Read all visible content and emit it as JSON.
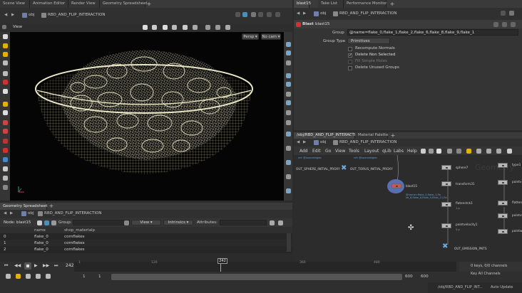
{
  "left_tabs": {
    "items": [
      "Scene View",
      "Animation Editor",
      "Render View",
      "Geometry Spreadsheet"
    ],
    "add": "+"
  },
  "left_path": {
    "context": "obj",
    "node": "RBD_AND_FLIP_INTERACTION"
  },
  "viewport": {
    "label": "View",
    "camera_btn": "Persp",
    "cam_btn": "No cam"
  },
  "right_top_tabs": {
    "items": [
      "blast15",
      "Take List",
      "Performance Monitor"
    ],
    "add": "+"
  },
  "right_top_path": {
    "context": "obj",
    "node": "RBD_AND_FLIP_INTERACTION"
  },
  "params": {
    "node_type": "Blast",
    "node_name": "blast15",
    "group_label": "Group",
    "group_value": "@name=flake_0,flake_1,flake_2,flake_6,flake_8,flake_9,flake_1",
    "group_type_label": "Group Type",
    "group_type_value": "Primitives",
    "recompute_normals": "Recompute Normals",
    "delete_non_selected": "Delete Non Selected",
    "fill_simple_holes": "Fill Simple Holes",
    "delete_unused_groups": "Delete Unused Groups"
  },
  "net_tabs": {
    "items": [
      "/obj/RBD_AND_FLIP_INTERACTION",
      "Material Palette"
    ],
    "add": "+"
  },
  "net_path": {
    "context": "obj",
    "node": "RBD_AND_FLIP_INTERACTION"
  },
  "net_menu": [
    "Add",
    "Edit",
    "Go",
    "View",
    "Tools",
    "Layout",
    "qLib",
    "Labs",
    "Help"
  ],
  "net_watermark": "Geometry",
  "net_nodes": {
    "out_sphere": "OUT_SPHERE_INITIAL_PROXY",
    "out_torus": "OUT_TORUS_INITIAL_PROXY",
    "ref_sphere": "ref: @sourcestgeo",
    "ref_torus": "ref: @sourcestgeo",
    "blast": "blast15",
    "blast_sub": "@name=flake_0,flake_1,fla ke_6,flake_8,flake_9,flake_11,fla",
    "sphere": "sphere7",
    "transform": "transform31",
    "flatten": "flatenstck1",
    "point_velocity": "pointvelocity1",
    "out_emission": "OUT_EMISSION_PNTS",
    "small_a": "1 p",
    "small_b": "5 p",
    "right_a": "type1",
    "right_b": "pointv",
    "right_c": "flatten",
    "right_d": "pointvi",
    "right_e": "pointw"
  },
  "sheet": {
    "tab": "Geometry Spreadsheet",
    "add": "+",
    "path_node": "RBD_AND_FLIP_INTERACTION",
    "path_ctx": "obj",
    "node_label": "Node: blast15",
    "group_label": "Group:",
    "view_btn": "View",
    "intrinsics_btn": "Intrinsics",
    "attributes_label": "Attributes:",
    "columns": [
      "name",
      "shop_materialp"
    ],
    "rows": [
      {
        "index": "0",
        "name": "flake_0",
        "material": "cornflakes"
      },
      {
        "index": "1",
        "name": "flake_0",
        "material": "cornflakes"
      },
      {
        "index": "2",
        "name": "flake_0",
        "material": "cornflakes"
      }
    ]
  },
  "timeline": {
    "frame": "242",
    "frame_marker": "242",
    "ticks": [
      "1",
      "120",
      "240",
      "360",
      "480"
    ],
    "start_a": "1",
    "start_b": "1",
    "end_a": "600",
    "end_b": "600",
    "keys_info": "0 keys, 0/0 channels",
    "key_all": "Key All Channels",
    "path": "/obj/RBD_AND_FLIP_INT...",
    "auto_update": "Auto Update"
  },
  "colors": {
    "accent": "#e3b200",
    "wire": "#ece8c6",
    "blue_node": "#5a6fb2"
  }
}
